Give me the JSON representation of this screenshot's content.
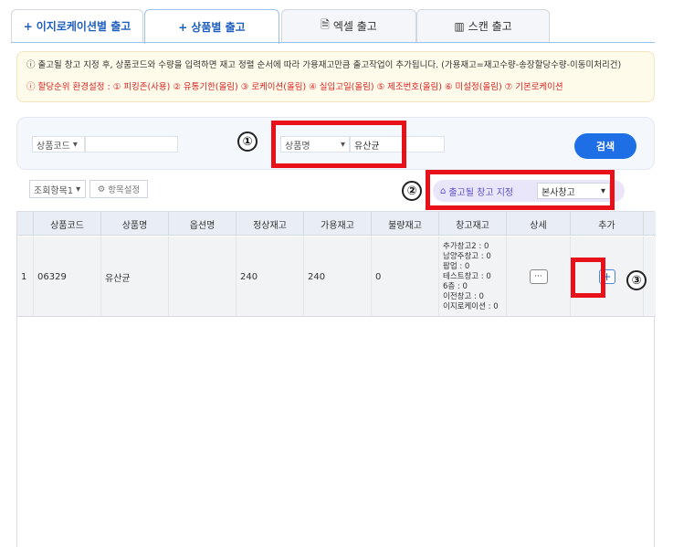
{
  "tabs": [
    {
      "label": "이지로케이션별 출고",
      "icon": "+"
    },
    {
      "label": "상품별 출고",
      "icon": "+"
    },
    {
      "label": "엑셀 출고",
      "icon": "🗎"
    },
    {
      "label": "스캔 출고",
      "icon": "▥"
    }
  ],
  "notice": {
    "line1": "ⓘ 출고될 창고 지정 후, 상품코드와 수량을 입력하면 재고 정렬 순서에 따라 가용재고만큼 출고작업이 추가됩니다. (가용재고=재고수량-송장할당수량-이동미처리건)",
    "line2": "ⓘ 할당순위 환경설정 : ① 피킹존(사용) ② 유통기한(올림) ③ 로케이션(올림) ④ 실입고일(올림) ⑤ 제조번호(올림) ⑥ 미설정(올림) ⑦ 기본로케이션"
  },
  "search": {
    "code_select": "상품코드",
    "code_value": "",
    "name_select": "상품명",
    "name_value": "유산균",
    "empty_value": "",
    "button": "검색"
  },
  "toolbar": {
    "view_select": "조회항목1",
    "settings_button": "항목설정",
    "warehouse_label": "출고될 창고 지정",
    "warehouse_value": "본사창고"
  },
  "table": {
    "headers": [
      "상품코드",
      "상품명",
      "옵션명",
      "정상재고",
      "가용재고",
      "불량재고",
      "창고재고",
      "상세",
      "추가"
    ],
    "rows": [
      {
        "no": "1",
        "code": "06329",
        "name": "유산균",
        "option": "",
        "normal": "240",
        "available": "240",
        "defect": "0",
        "stock": [
          "추가창고2 : 0",
          "남양주창고 : 0",
          "팝업 : 0",
          "테스트창고 : 0",
          "6층 : 0",
          "이전창고 : 0",
          "이지로케이션 : 0"
        ],
        "detail": "···",
        "add": "+"
      }
    ]
  },
  "annotations": {
    "a1": "①",
    "a2": "②",
    "a3": "③"
  },
  "colors": {
    "highlight": "#e8111a",
    "primary": "#1e6ee6",
    "warn": "#d62222"
  }
}
